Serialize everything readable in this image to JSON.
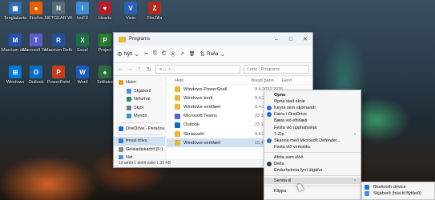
{
  "desktop": {
    "icons": [
      {
        "label": "Tenglakarta",
        "glyph": "▦",
        "color": "#2f6fb3"
      },
      {
        "label": "Firefox",
        "glyph": "●",
        "color": "#e66000"
      },
      {
        "label": "NETGEAR WNDA31...",
        "glyph": "N",
        "color": "#5a6b78"
      },
      {
        "label": "IcoFX",
        "glyph": "I",
        "color": "#3d8bd9"
      },
      {
        "label": "Hearts",
        "glyph": "♥",
        "color": "#b81d2b"
      },
      {
        "label": "Visio",
        "glyph": "V",
        "color": "#2b5fb5"
      },
      {
        "label": "FileZilla",
        "glyph": "Z",
        "color": "#b02a1f"
      },
      {
        "label": "Macrium viBoot",
        "glyph": "M",
        "color": "#2255aa"
      },
      {
        "label": "Microsoft Teams",
        "glyph": "T",
        "color": "#5b5fc7"
      },
      {
        "label": "Macrium Reflect",
        "glyph": "R",
        "color": "#1f4e9c"
      },
      {
        "label": "Excel",
        "glyph": "X",
        "color": "#1d7044"
      },
      {
        "label": "Project",
        "glyph": "P",
        "color": "#2e7d32"
      },
      {
        "label": "Windows",
        "glyph": "⊞",
        "color": "#0078d4"
      },
      {
        "label": "Outlook",
        "glyph": "O",
        "color": "#0f6cbd"
      },
      {
        "label": "PowerPoint",
        "glyph": "P",
        "color": "#c43e1c"
      },
      {
        "label": "Word",
        "glyph": "W",
        "color": "#185abd"
      },
      {
        "label": "Solitaire",
        "glyph": "♠",
        "color": "#2d6e3e"
      }
    ]
  },
  "window": {
    "title": "Programs",
    "toolbar": {
      "new_label": "Nýtt",
      "sort_label": "Raða"
    },
    "address": {
      "path": "« ... ›",
      "search_placeholder": "Leita í Programs"
    },
    "columns": {
      "name": "Heiti",
      "date": "Breytt þann",
      "type": "Gerð"
    },
    "nav": [
      {
        "label": "Heim",
        "icon_color": "#e0a030",
        "indent": false
      },
      {
        "label": "Skjáborð",
        "icon_color": "#4a8fe0",
        "indent": true
      },
      {
        "label": "Niðurhal",
        "icon_color": "#2f8f5a",
        "indent": true
      },
      {
        "label": "Skjöl",
        "icon_color": "#6a7c8e",
        "indent": true
      },
      {
        "label": "Myndir",
        "icon_color": "#3a8fd0",
        "indent": true
      },
      {
        "label": "OneDrive - Persónu...",
        "icon_color": "#1f6fd0",
        "indent": false
      },
      {
        "label": "Þessi tölva",
        "icon_color": "#3a7fc0",
        "indent": false,
        "selected": true
      },
      {
        "label": "Geisladiskadrif (F:)",
        "icon_color": "#888888",
        "indent": false
      },
      {
        "label": "Net",
        "icon_color": "#4a8fe0",
        "indent": false
      }
    ],
    "files": [
      {
        "name": "Windows PowerShell",
        "date": "9.4.2022 2025",
        "color": "#e8b73a"
      },
      {
        "name": "Windows-kerfi",
        "date": "9.4.2022",
        "color": "#e8b73a"
      },
      {
        "name": "Windows-verkfæri",
        "date": "9.4.2022",
        "color": "#e8b73a"
      },
      {
        "name": "Microsoft Teams",
        "date": "23.1.2022",
        "color": "#5b5fc7"
      },
      {
        "name": "Outlook",
        "date": "23.1.2022",
        "color": "#0f6cbd"
      },
      {
        "name": "Skráavafri",
        "date": "9.4.2022",
        "color": "#e8b73a"
      },
      {
        "name": "Windows-verkfæri",
        "date": "15.4.2022",
        "color": "#e8b73a",
        "selected": true
      }
    ],
    "status": "12 atriði    1 atriði valið  1,35 KB"
  },
  "context_menu": {
    "items": [
      {
        "label": "Opna",
        "bold": true
      },
      {
        "label": "Opna stað skrár"
      },
      {
        "label": "Keyra sem stjórnandi",
        "icon_color": "#2a6ed0"
      },
      {
        "label": "Færa í OneDrive",
        "icon_color": "#1f6fd0"
      },
      {
        "label": "Bæta við eftirlæti"
      },
      {
        "label": "Festa við upphafsskjá"
      },
      {
        "label": "7-Zip",
        "arrow": true
      },
      {
        "label": "Skanna með Microsoft Defender...",
        "icon_color": "#2a6ed0"
      },
      {
        "label": "Festa við verkstiku"
      },
      {
        "sep": true
      },
      {
        "label": "Afrita sem slóð"
      },
      {
        "label": "Deila",
        "icon_color": "#3a3a3a"
      },
      {
        "label": "Endurheimta fyrri útgáfur"
      },
      {
        "sep": true
      },
      {
        "label": "Senda til",
        "arrow": true,
        "highlight": true
      },
      {
        "sep": true
      },
      {
        "label": "Klippa"
      }
    ]
  },
  "submenu": {
    "items": [
      {
        "label": "Bluetooth device",
        "icon_color": "#1f6fd0"
      },
      {
        "label": "Skjáborð (búa til flýtileið)",
        "icon_color": "#4a8fe0"
      }
    ]
  }
}
